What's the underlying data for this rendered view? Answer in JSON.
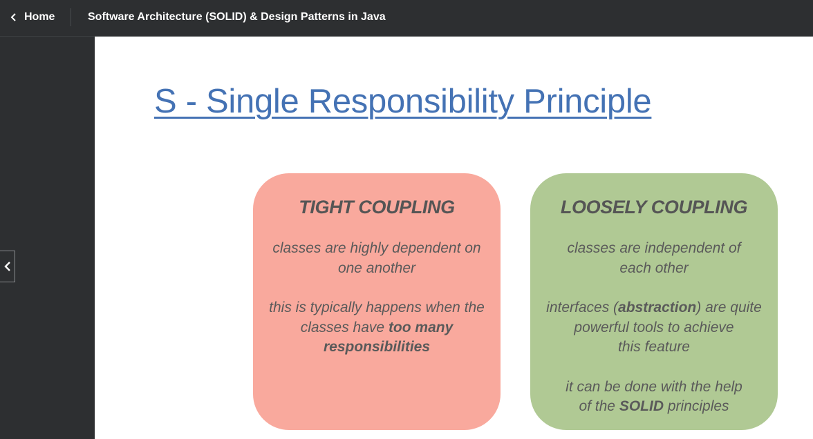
{
  "header": {
    "home_label": "Home",
    "course_title": "Software Architecture (SOLID) & Design Patterns in Java"
  },
  "slide": {
    "title": "S - Single Responsibility Principle",
    "tight": {
      "heading": "TIGHT COUPLING",
      "p1_line1": "classes are highly dependent on",
      "p1_line2": "one another",
      "p2_line1": "this is typically happens when the",
      "p2_line2_pre": "classes have ",
      "p2_line2_bold": "too many",
      "p2_line3_bold": "responsibilities"
    },
    "loose": {
      "heading": "LOOSELY COUPLING",
      "p1_line1": "classes are independent of",
      "p1_line2": "each other",
      "p2_line1_pre": "interfaces (",
      "p2_line1_bold": "abstraction",
      "p2_line1_post": ") are quite",
      "p2_line2": "powerful tools to achieve",
      "p2_line3": "this feature",
      "p3_line1": "it can be done with the help",
      "p3_line2_pre": "of the ",
      "p3_line2_bold": "SOLID",
      "p3_line2_post": " principles"
    }
  },
  "icons": {
    "home_chevron": "chevron-left-icon",
    "collapse_chevron": "chevron-left-icon"
  },
  "colors": {
    "bar_bg": "#2d2f31",
    "title_blue": "#4472b4",
    "tight_card": "#f9a99d",
    "loose_card": "#b0c994"
  }
}
